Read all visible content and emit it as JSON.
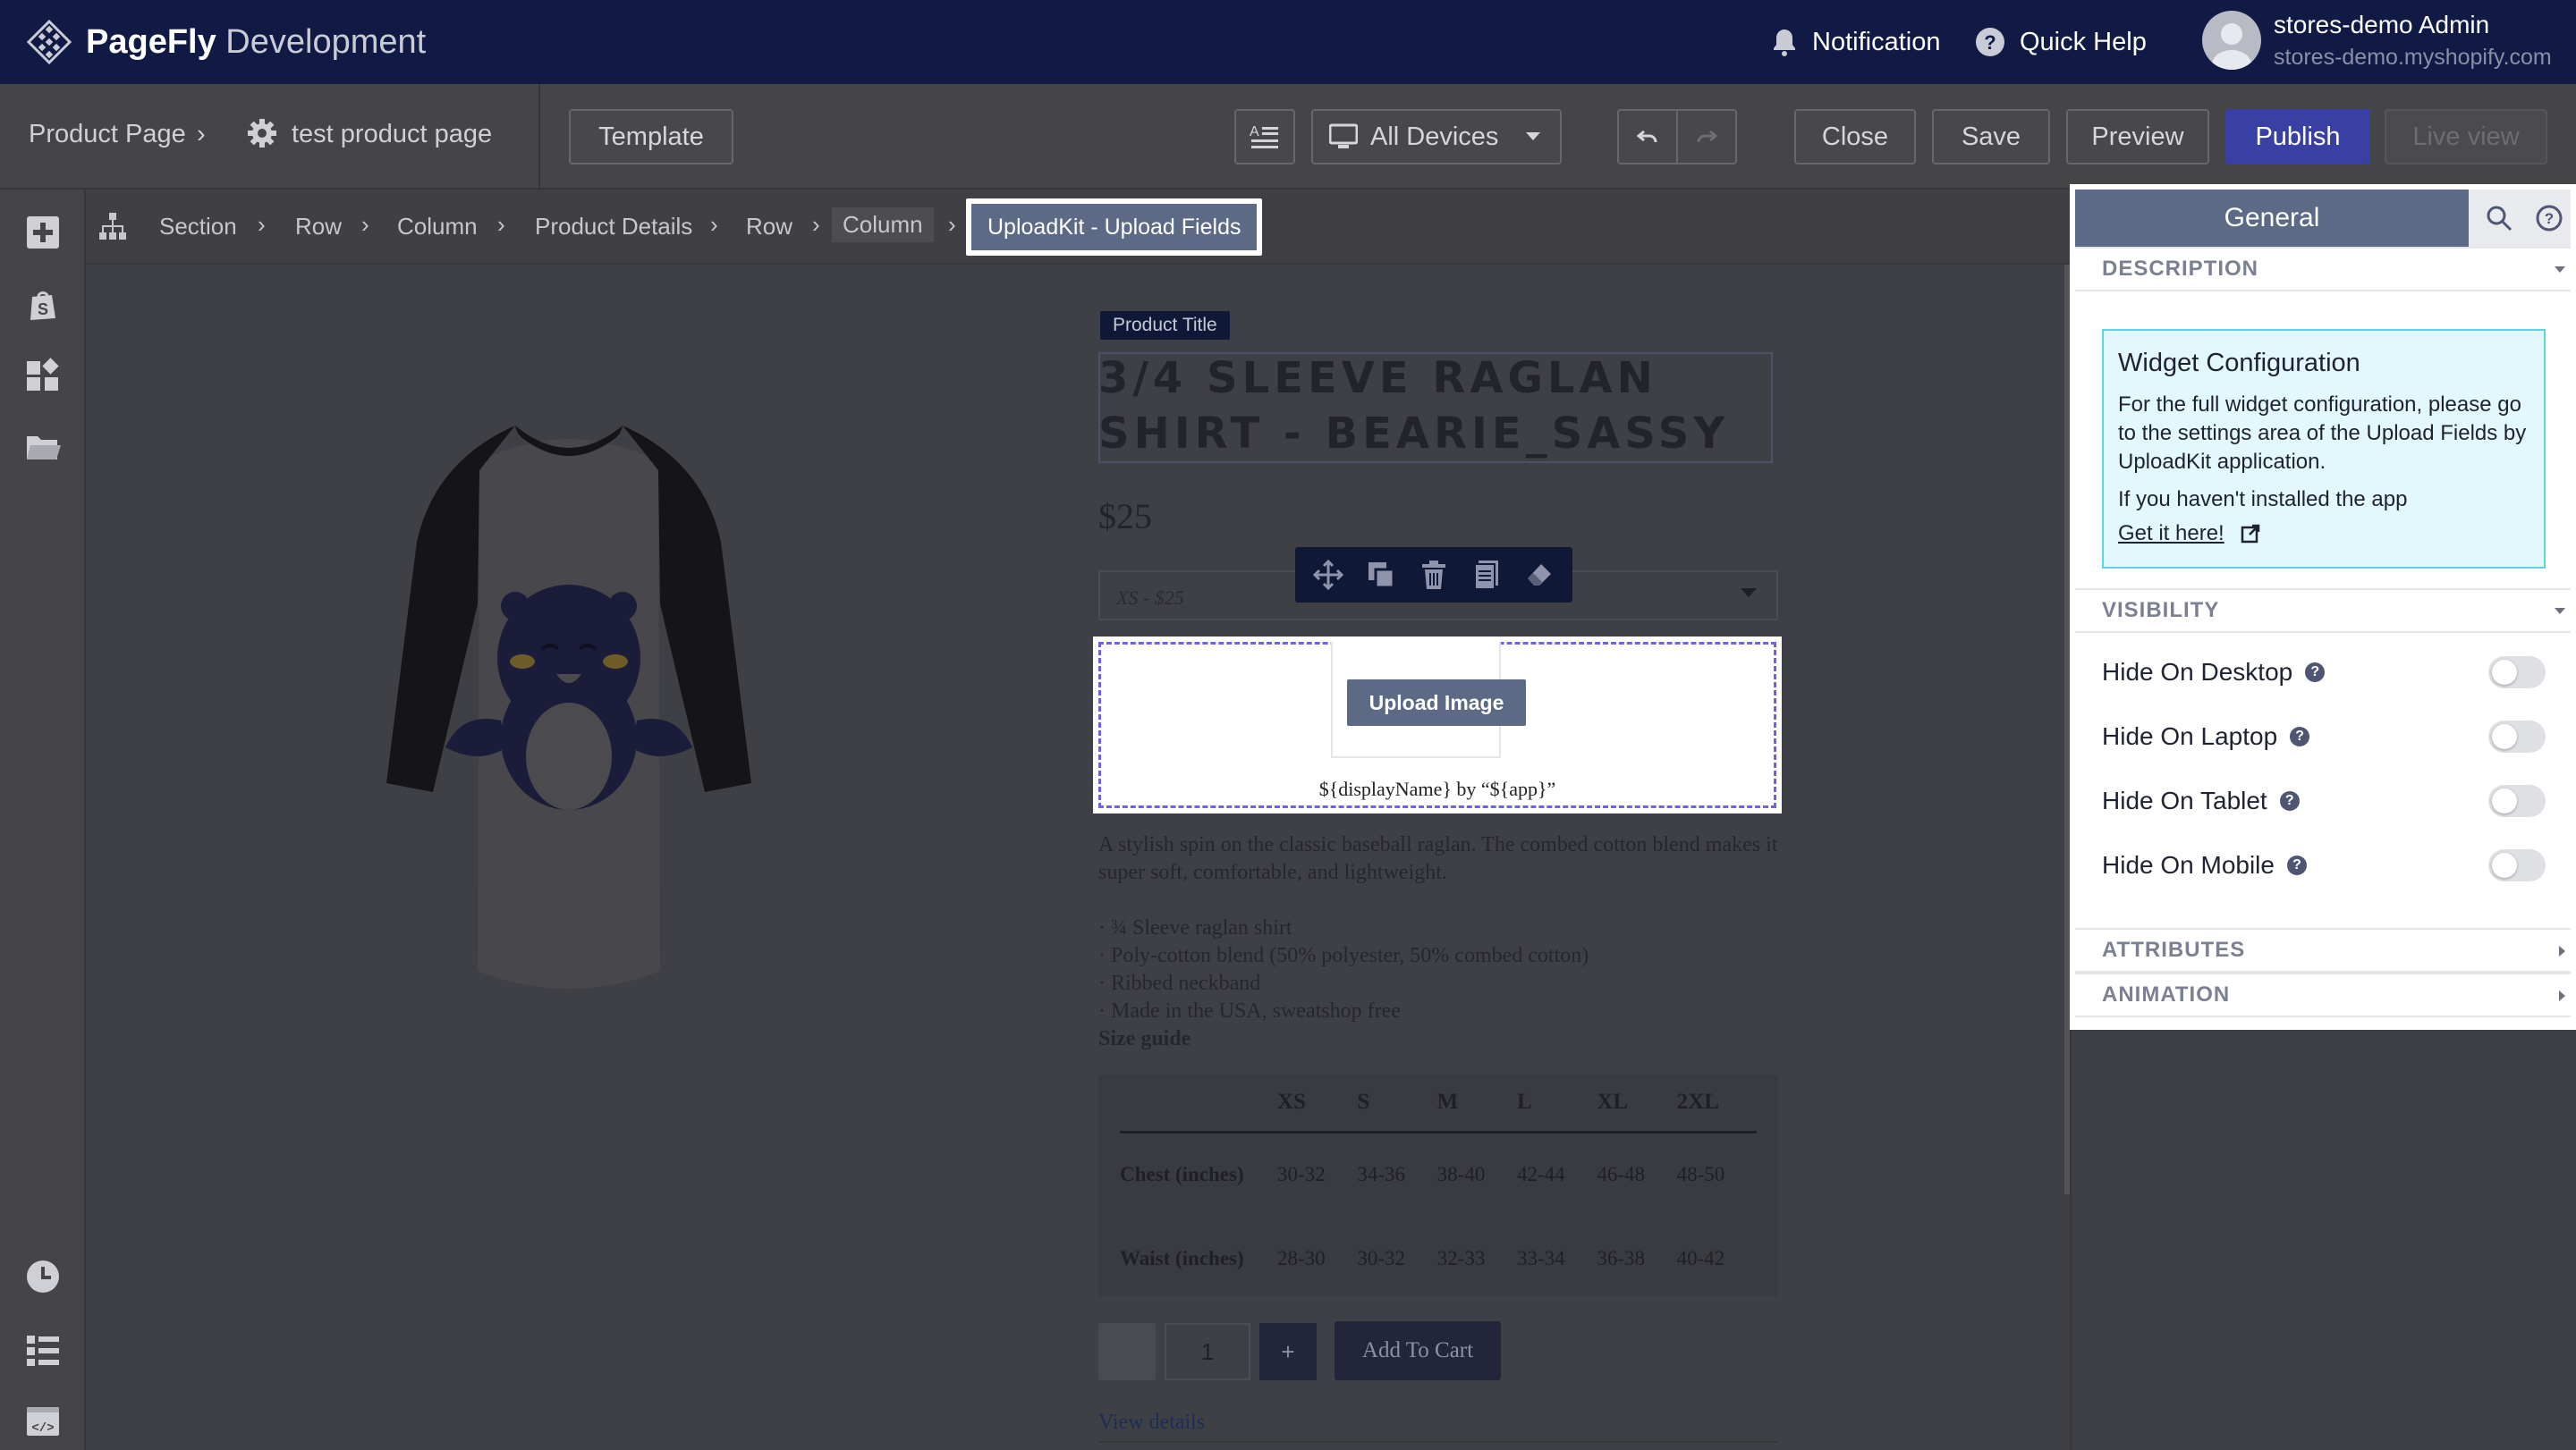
{
  "app": {
    "brand_strong": "PageFly",
    "brand_light": " Development",
    "notification_label": "Notification",
    "quick_help_label": "Quick Help",
    "user_name": "stores-demo Admin",
    "user_store": "stores-demo.myshopify.com"
  },
  "toolbar": {
    "page_type": "Product Page",
    "page_name": "test product page",
    "template_label": "Template",
    "devices_label": "All Devices",
    "close_label": "Close",
    "save_label": "Save",
    "preview_label": "Preview",
    "publish_label": "Publish",
    "live_view_label": "Live view"
  },
  "breadcrumb": {
    "items": [
      "Section",
      "Row",
      "Column",
      "Product Details",
      "Row",
      "Column"
    ],
    "active": "UploadKit - Upload Fields"
  },
  "product": {
    "title_tag": "Product Title",
    "title": "3/4 SLEEVE RAGLAN SHIRT - BEARIE_SASSY",
    "price": "$25",
    "variant": "XS - $25",
    "upload_button": "Upload Image",
    "upload_caption": "${displayName} by “${app}”",
    "description": "A stylish spin on the classic baseball raglan. The combed cotton blend makes it super soft, comfortable, and lightweight.",
    "bullets": [
      "· ¾ Sleeve raglan shirt",
      "· Poly-cotton blend (50% polyester, 50% combed cotton)",
      "· Ribbed neckband",
      "· Made in the USA, sweatshop free"
    ],
    "size_guide_label": "Size guide",
    "size_table": {
      "headers": [
        "",
        "XS",
        "S",
        "M",
        "L",
        "XL",
        "2XL"
      ],
      "rows": [
        {
          "label": "Chest (inches)",
          "values": [
            "30-32",
            "34-36",
            "38-40",
            "42-44",
            "46-48",
            "48-50"
          ]
        },
        {
          "label": "Waist (inches)",
          "values": [
            "28-30",
            "30-32",
            "32-33",
            "33-34",
            "36-38",
            "40-42"
          ]
        }
      ]
    },
    "quantity": "1",
    "plus_label": "+",
    "add_to_cart": "Add To Cart",
    "view_details": "View details"
  },
  "panel": {
    "tab_general": "General",
    "section_description": "DESCRIPTION",
    "info_title": "Widget Configuration",
    "info_body": "For the full widget configuration, please go to the settings area of the Upload Fields by UploadKit application.",
    "info_body2": "If you haven't installed the app",
    "info_link": "Get it here!",
    "section_visibility": "VISIBILITY",
    "visibility": [
      {
        "label": "Hide On Desktop",
        "on": false
      },
      {
        "label": "Hide On Laptop",
        "on": false
      },
      {
        "label": "Hide On Tablet",
        "on": false
      },
      {
        "label": "Hide On Mobile",
        "on": false
      }
    ],
    "section_attributes": "ATTRIBUTES",
    "section_animation": "ANIMATION"
  },
  "colors": {
    "topbar": "#111a44",
    "publish": "#3a3fa4",
    "accent_slate": "#5c6a86",
    "info_bg": "#e2f8fc",
    "dashed_highlight": "#6e63e8"
  }
}
